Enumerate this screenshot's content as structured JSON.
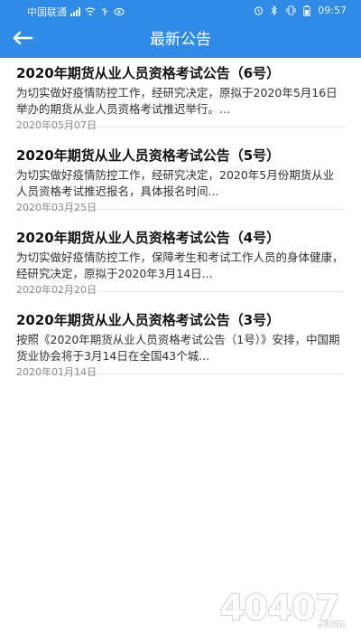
{
  "status_bar": {
    "carrier": "中国联通",
    "time": "09:57",
    "icons": [
      "signal-icon",
      "wifi-icon",
      "usb-icon",
      "eye-icon",
      "alarm-icon",
      "bluetooth-icon",
      "vibrate-icon",
      "battery-icon"
    ]
  },
  "app_bar": {
    "title": "最新公告",
    "back_icon": "arrow-left-icon"
  },
  "announcements": [
    {
      "title": "2020年期货从业人员资格考试公告（6号）",
      "summary": "为切实做好疫情防控工作，经研究决定，原拟于2020年5月16日举办的期货从业人员资格考试推迟举行。...",
      "date": "2020年05月07日"
    },
    {
      "title": "2020年期货从业人员资格考试公告（5号）",
      "summary": "为切实做好疫情防控工作，经研究决定，2020年5月份期货从业人员资格考试推迟报名，具体报名时间...",
      "date": "2020年03月25日"
    },
    {
      "title": "2020年期货从业人员资格考试公告（4号）",
      "summary": "为切实做好疫情防控工作，保障考生和考试工作人员的身体健康，经研究决定，原拟于2020年3月14日...",
      "date": "2020年02月20日"
    },
    {
      "title": "2020年期货从业人员资格考试公告（3号）",
      "summary": "按照《2020年期货从业人员资格考试公告（1号）》安排，中国期货业协会将于3月14日在全国43个城...",
      "date": "2020年01月14日"
    }
  ],
  "watermark": {
    "text": "40407",
    "suffix": ".com"
  },
  "colors": {
    "header_blue": "#2f8be6",
    "title_text": "#111111",
    "date_text": "#8a8a8a"
  }
}
